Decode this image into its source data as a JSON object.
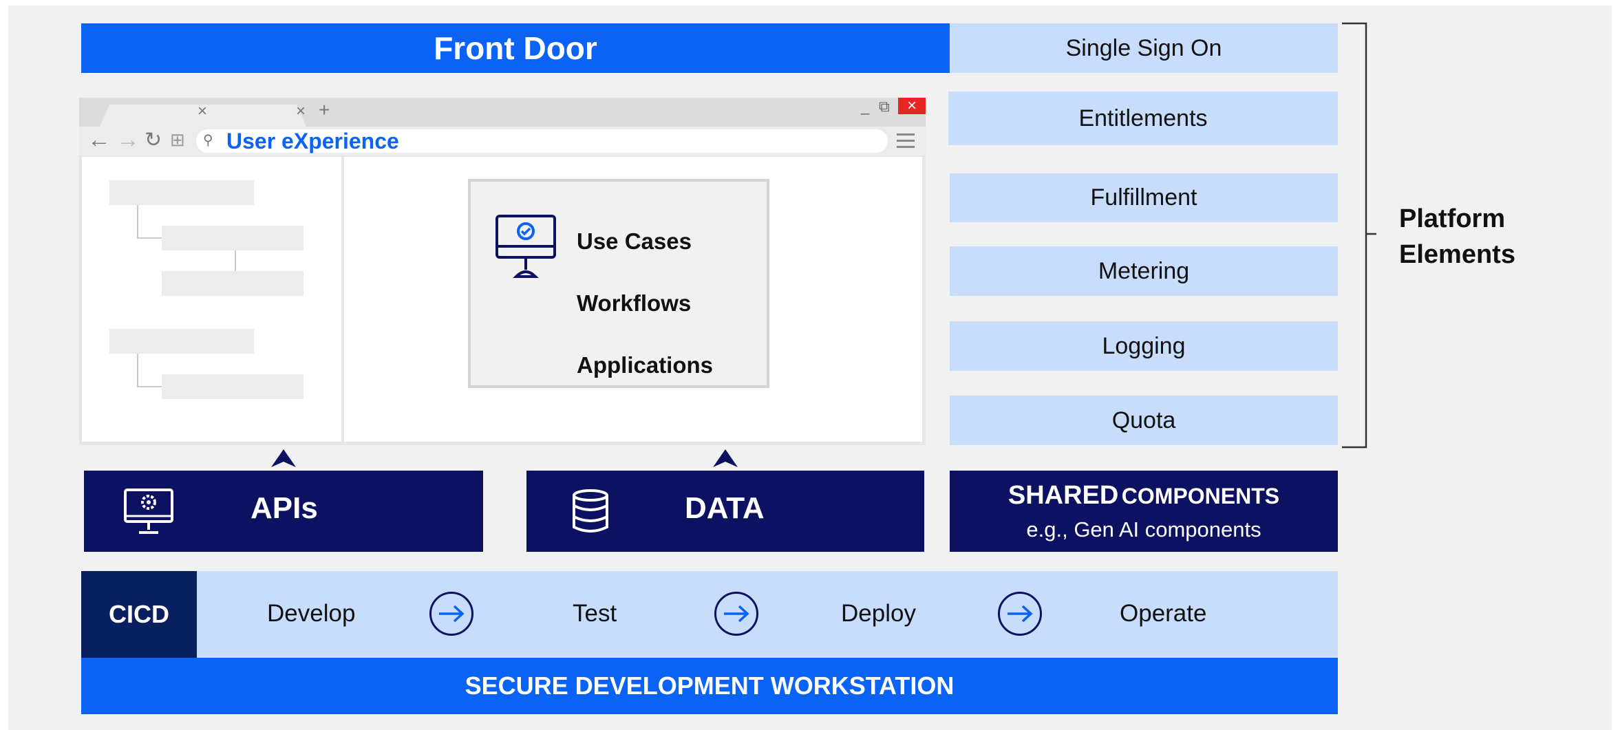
{
  "front_door": {
    "label": "Front Door"
  },
  "browser": {
    "address_text": "User eXperience"
  },
  "use_case_box": {
    "items": [
      "Use Cases",
      "Workflows",
      "Applications"
    ]
  },
  "platform_elements": {
    "items": [
      "Single Sign On",
      "Entitlements",
      "Fulfillment",
      "Metering",
      "Logging",
      "Quota"
    ],
    "bracket_label_line1": "Platform",
    "bracket_label_line2": "Elements"
  },
  "apis": {
    "label": "APIs"
  },
  "data": {
    "label": "DATA"
  },
  "shared": {
    "title_bold": "SHARED",
    "title_rest": "COMPONENTS",
    "subtitle": "e.g., Gen AI components"
  },
  "cicd": {
    "label": "CICD",
    "steps": [
      "Develop",
      "Test",
      "Deploy",
      "Operate"
    ]
  },
  "workstation": {
    "label": "SECURE DEVELOPMENT WORKSTATION"
  },
  "colors": {
    "primary_blue": "#0a63f5",
    "light_blue": "#c8dcfb",
    "navy": "#0c1261",
    "close_red": "#e82525"
  },
  "icons": [
    "monitor-check-icon",
    "monitor-gear-icon",
    "database-icon",
    "arrow-right-circle-icon",
    "search-icon",
    "close-icon"
  ]
}
